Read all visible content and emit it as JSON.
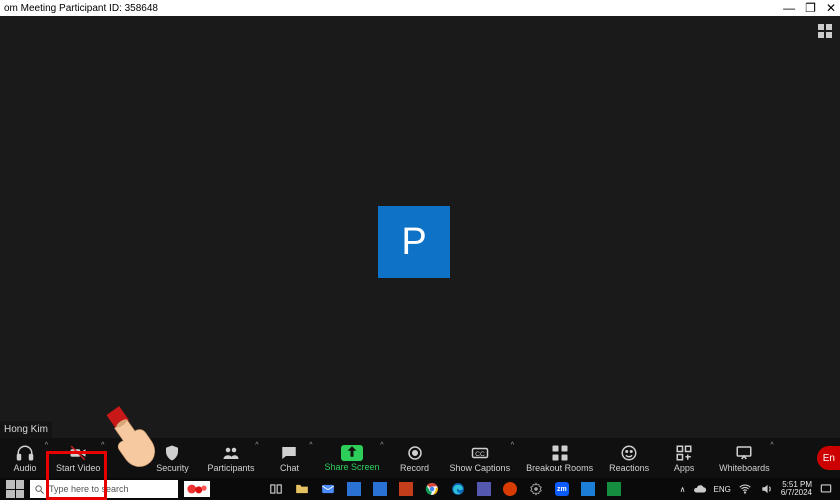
{
  "titlebar": {
    "title": "om Meeting Participant ID: 358648"
  },
  "video": {
    "avatar_initial": "P",
    "name_label": "Hong Kim"
  },
  "zoombar": {
    "audio": {
      "label": "Audio"
    },
    "video": {
      "label": "Start Video"
    },
    "security": {
      "label": "Security"
    },
    "participants": {
      "label": "Participants"
    },
    "chat": {
      "label": "Chat"
    },
    "share": {
      "label": "Share Screen"
    },
    "record": {
      "label": "Record"
    },
    "captions": {
      "label": "Show Captions"
    },
    "breakout": {
      "label": "Breakout Rooms"
    },
    "reactions": {
      "label": "Reactions"
    },
    "apps": {
      "label": "Apps"
    },
    "whiteboards": {
      "label": "Whiteboards"
    },
    "end": {
      "label": "En"
    }
  },
  "taskbar": {
    "search_placeholder": "Type here to search",
    "time": "5:51 PM",
    "date": "6/7/2024"
  }
}
